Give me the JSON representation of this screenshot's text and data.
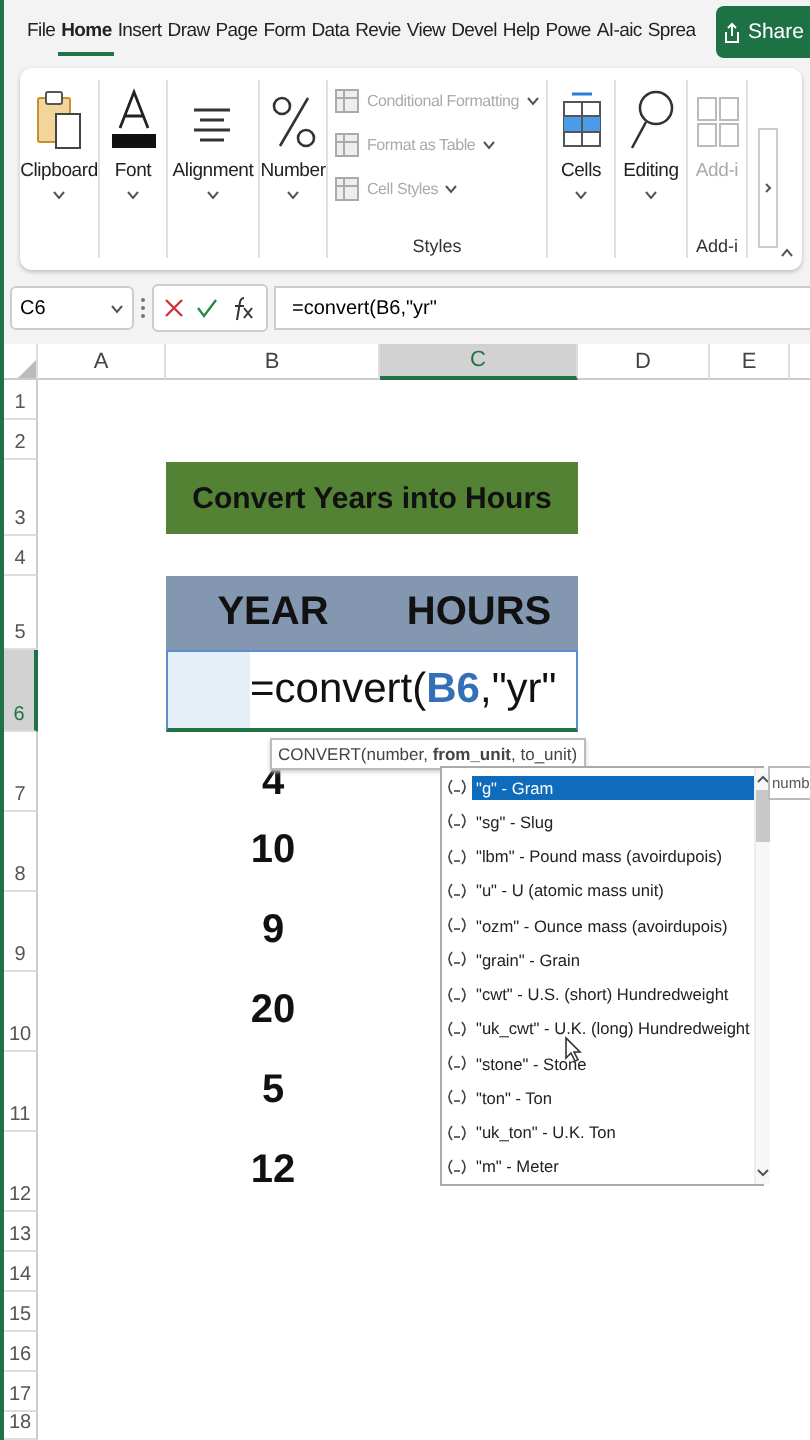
{
  "ribbon_tabs": [
    {
      "label": "File",
      "selected": false
    },
    {
      "label": "Home",
      "selected": true
    },
    {
      "label": "Insert",
      "selected": false
    },
    {
      "label": "Draw",
      "selected": false
    },
    {
      "label": "Page",
      "selected": false
    },
    {
      "label": "Form",
      "selected": false
    },
    {
      "label": "Data",
      "selected": false
    },
    {
      "label": "Revie",
      "selected": false
    },
    {
      "label": "View",
      "selected": false
    },
    {
      "label": "Devel",
      "selected": false
    },
    {
      "label": "Help",
      "selected": false
    },
    {
      "label": "Powe",
      "selected": false
    },
    {
      "label": "AI-aic",
      "selected": false
    },
    {
      "label": "Sprea",
      "selected": false
    }
  ],
  "share_button": {
    "label": "Share"
  },
  "ribbon_groups": [
    {
      "kind": "clipboard",
      "label": "Clipboard",
      "disabled": false
    },
    {
      "kind": "font",
      "label": "Font",
      "disabled": false
    },
    {
      "kind": "alignment",
      "label": "Alignment",
      "disabled": false
    },
    {
      "kind": "number",
      "label": "Number",
      "disabled": false
    },
    {
      "kind": "styles",
      "label": "Styles",
      "items": [
        {
          "label": "Conditional Formatting"
        },
        {
          "label": "Format as Table"
        },
        {
          "label": "Cell Styles"
        }
      ]
    },
    {
      "kind": "cells",
      "label": "Cells",
      "disabled": false
    },
    {
      "kind": "editing",
      "label": "Editing",
      "disabled": false
    },
    {
      "kind": "addins",
      "label": "Add-i",
      "group_label": "Add-i",
      "disabled": true
    }
  ],
  "formula_bar": {
    "name_box": "C6",
    "formula": "=convert(B6,\"yr\""
  },
  "columns": [
    {
      "label": "A",
      "selected": false
    },
    {
      "label": "B",
      "selected": false
    },
    {
      "label": "C",
      "selected": true
    },
    {
      "label": "D",
      "selected": false
    },
    {
      "label": "E",
      "selected": false
    }
  ],
  "rows": [
    {
      "number": "1",
      "kind": "empty",
      "selected": false
    },
    {
      "number": "2",
      "kind": "empty",
      "selected": false
    },
    {
      "number": "3",
      "kind": "title",
      "selected": false,
      "text": "Convert Years into Hours"
    },
    {
      "number": "4",
      "kind": "empty",
      "selected": false
    },
    {
      "number": "5",
      "kind": "header",
      "selected": false,
      "cells": [
        "YEAR",
        "HOURS"
      ]
    },
    {
      "number": "6",
      "kind": "edit",
      "selected": true,
      "parts": [
        {
          "text": "=convert(",
          "kind": "plain"
        },
        {
          "text": "B6",
          "kind": "ref"
        },
        {
          "text": ",\"yr\"",
          "kind": "plain"
        }
      ]
    },
    {
      "number": "7",
      "kind": "value",
      "selected": false,
      "text": "4"
    },
    {
      "number": "8",
      "kind": "value",
      "selected": false,
      "text": "10"
    },
    {
      "number": "9",
      "kind": "value",
      "selected": false,
      "text": "9"
    },
    {
      "number": "10",
      "kind": "value",
      "selected": false,
      "text": "20"
    },
    {
      "number": "11",
      "kind": "value",
      "selected": false,
      "text": "5"
    },
    {
      "number": "12",
      "kind": "value",
      "selected": false,
      "text": "12"
    },
    {
      "number": "13",
      "kind": "empty",
      "selected": false
    },
    {
      "number": "14",
      "kind": "empty",
      "selected": false
    },
    {
      "number": "15",
      "kind": "empty",
      "selected": false
    },
    {
      "number": "16",
      "kind": "empty",
      "selected": false
    },
    {
      "number": "17",
      "kind": "empty",
      "selected": false
    },
    {
      "number": "18",
      "kind": "empty",
      "selected": false
    }
  ],
  "function_tooltip": "CONVERT(number, **from_unit**, to_unit)",
  "autocomplete": [
    {
      "label": "\"g\" - Gram",
      "selected": true
    },
    {
      "label": "\"sg\" - Slug",
      "selected": false
    },
    {
      "label": "\"lbm\" - Pound mass (avoirdupois)",
      "selected": false
    },
    {
      "label": "\"u\" - U (atomic mass unit)",
      "selected": false
    },
    {
      "label": "\"ozm\" - Ounce mass (avoirdupois)",
      "selected": false
    },
    {
      "label": "\"grain\" - Grain",
      "selected": false
    },
    {
      "label": "\"cwt\" - U.S. (short) Hundredweight",
      "selected": false
    },
    {
      "label": "\"uk_cwt\" - U.K. (long) Hundredweight",
      "selected": false
    },
    {
      "label": "\"stone\" - Stone",
      "selected": false
    },
    {
      "label": "\"ton\" - Ton",
      "selected": false
    },
    {
      "label": "\"uk_ton\" - U.K. Ton",
      "selected": false
    },
    {
      "label": "\"m\" - Meter",
      "selected": false
    }
  ],
  "side_tooltip": "numb"
}
